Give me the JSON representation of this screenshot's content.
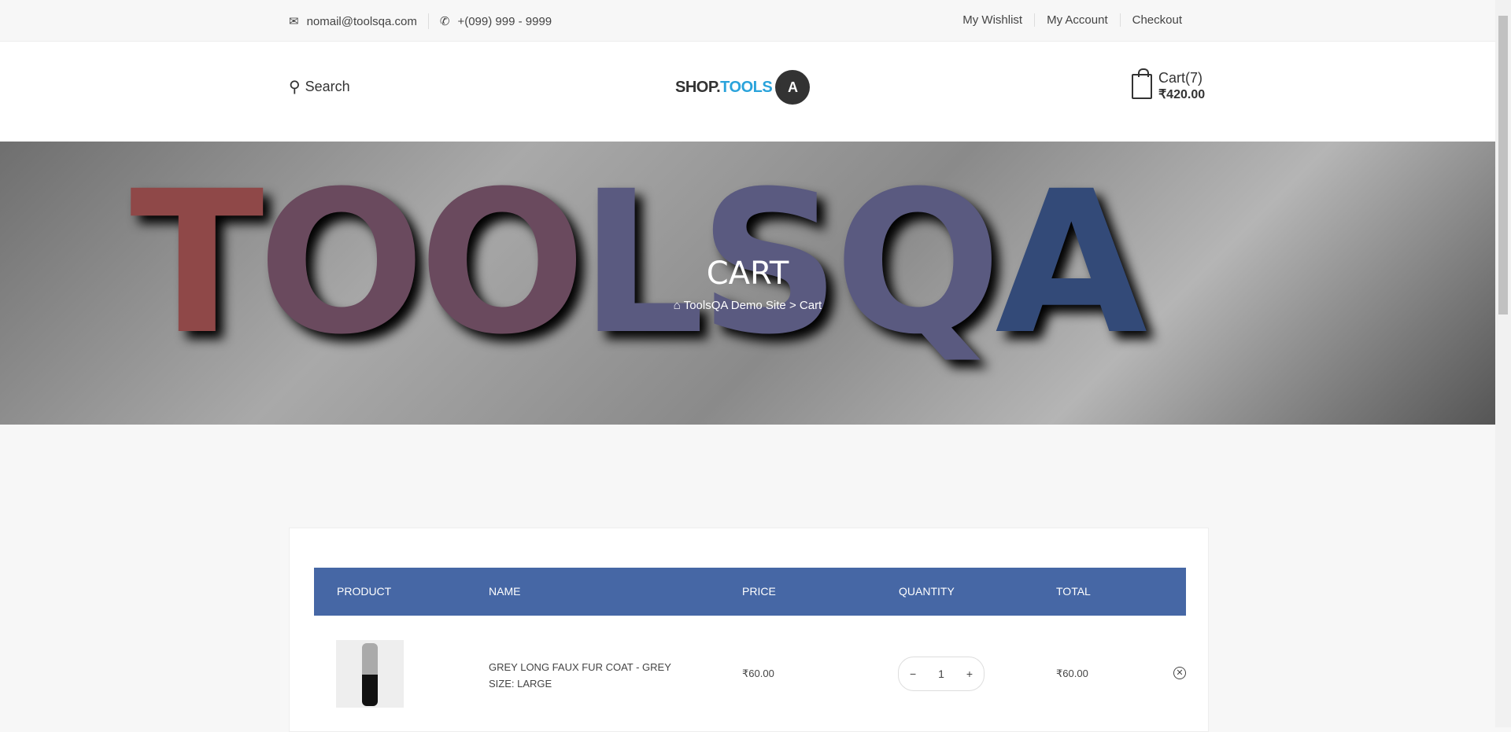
{
  "topbar": {
    "email": "nomail@toolsqa.com",
    "phone": "+(099) 999 - 9999",
    "links": [
      "My Wishlist",
      "My Account",
      "Checkout"
    ]
  },
  "header": {
    "search_label": "Search",
    "logo_text_1": "SHOP.",
    "logo_text_2": "TOOLS",
    "logo_gear_letter": "A",
    "cart_label": "Cart(7)",
    "cart_total": "₹420.00"
  },
  "banner": {
    "bg_text": [
      "TOOLS",
      "QA"
    ],
    "title": "CART",
    "breadcrumb": [
      "ToolsQA Demo Site",
      ">",
      "Cart"
    ]
  },
  "table": {
    "headers": [
      "PRODUCT",
      "NAME",
      "PRICE",
      "QUANTITY",
      "TOTAL"
    ],
    "rows": [
      {
        "name": "GREY LONG FAUX FUR COAT - GREY",
        "size": "SIZE: LARGE",
        "price": "₹60.00",
        "quantity": "1",
        "total": "₹60.00"
      }
    ]
  },
  "colors": {
    "table_header": "#4667a5",
    "logo_accent": "#2aa3db"
  }
}
